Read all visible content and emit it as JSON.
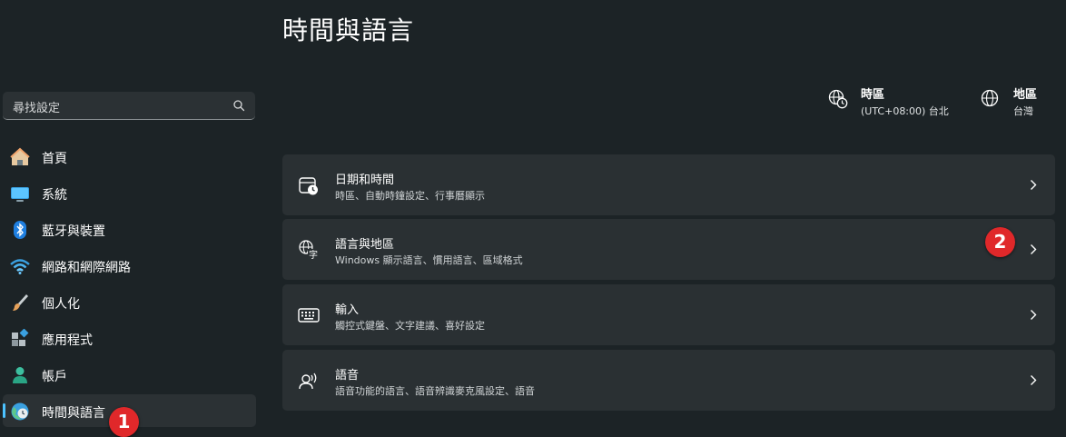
{
  "page": {
    "title": "時間與語言"
  },
  "search": {
    "placeholder": "尋找設定"
  },
  "sidebar": {
    "items": [
      {
        "label": "首頁",
        "icon": "home-icon"
      },
      {
        "label": "系統",
        "icon": "system-display-icon"
      },
      {
        "label": "藍牙與裝置",
        "icon": "bluetooth-icon"
      },
      {
        "label": "網路和網際網路",
        "icon": "wifi-icon"
      },
      {
        "label": "個人化",
        "icon": "paintbrush-icon"
      },
      {
        "label": "應用程式",
        "icon": "apps-icon"
      },
      {
        "label": "帳戶",
        "icon": "account-icon"
      },
      {
        "label": "時間與語言",
        "icon": "time-language-icon",
        "selected": true
      }
    ]
  },
  "header_info": {
    "timezone": {
      "title": "時區",
      "value": "(UTC+08:00) 台北"
    },
    "region": {
      "title": "地區",
      "value": "台灣"
    }
  },
  "cards": [
    {
      "title": "日期和時間",
      "subtitle": "時區、自動時鐘設定、行事曆顯示",
      "icon": "calendar-clock-icon"
    },
    {
      "title": "語言與地區",
      "subtitle": "Windows 顯示語言、慣用語言、區域格式",
      "icon": "language-icon"
    },
    {
      "title": "輸入",
      "subtitle": "觸控式鍵盤、文字建議、喜好設定",
      "icon": "keyboard-icon"
    },
    {
      "title": "語音",
      "subtitle": "語音功能的語言、語音辨識麥克風設定、語音",
      "icon": "speech-icon"
    }
  ],
  "annotations": {
    "badge1": "1",
    "badge2": "2"
  },
  "colors": {
    "accent": "#4cc2ff",
    "badge": "#e0282a",
    "background": "#1c2326",
    "card": "#2a3033"
  }
}
